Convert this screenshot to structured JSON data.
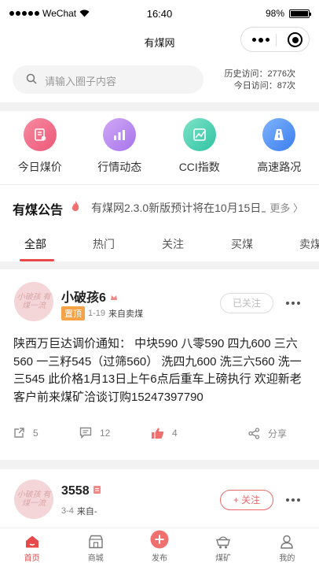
{
  "status": {
    "carrier": "WeChat",
    "time": "16:40",
    "battery": "98%",
    "battery_level": 0.98
  },
  "nav": {
    "title": "有煤网"
  },
  "search": {
    "placeholder": "请输入圈子内容"
  },
  "visits": {
    "history": "历史访问：2776次",
    "today": "今日访问：87次"
  },
  "quick": [
    {
      "label": "今日煤价",
      "icon": "document-icon",
      "color": "#f06a86"
    },
    {
      "label": "行情动态",
      "icon": "bar-chart-icon",
      "color": "#b889f0"
    },
    {
      "label": "CCI指数",
      "icon": "trend-icon",
      "color": "#40cfb0"
    },
    {
      "label": "高速路况",
      "icon": "road-icon",
      "color": "#4d8ef5"
    }
  ],
  "notice": {
    "heading": "有煤公告",
    "text": "有煤网2.3.0新版预计将在10月15日上线",
    "more": "更多 〉"
  },
  "tabs": [
    "全部",
    "热门",
    "关注",
    "买煤",
    "卖煤"
  ],
  "posts": [
    {
      "avatar_text": "小破孩 有煤一流",
      "name": "小破孩6",
      "pinned": "置顶",
      "date": "1-19",
      "source": "来自卖煤",
      "follow": "已关注",
      "content": "陕西万巨达调价通知： 中块590 八零590 四九600 三六560 一三籽545（过筛560） 洗四九600 洗三六560 洗一三545 此价格1月13日上午6点后重车上磅执行 欢迎新老客户前来煤矿洽谈订购15247397790",
      "shares": "5",
      "comments": "12",
      "likes": "4",
      "share_label": "分享"
    },
    {
      "avatar_text": "小破孩 有煤一流",
      "name": "3558",
      "date": "3-4",
      "source": "来自-",
      "follow": "+ 关注"
    }
  ],
  "tabbar": [
    {
      "label": "首页",
      "icon": "home-icon",
      "active": true
    },
    {
      "label": "商城",
      "icon": "shop-icon",
      "active": false
    },
    {
      "label": "发布",
      "icon": "plus-icon",
      "active": false
    },
    {
      "label": "煤矿",
      "icon": "mine-cart-icon",
      "active": false
    },
    {
      "label": "我的",
      "icon": "user-icon",
      "active": false
    }
  ],
  "colors": {
    "accent": "#e84848",
    "pinned": "#f5a346"
  }
}
